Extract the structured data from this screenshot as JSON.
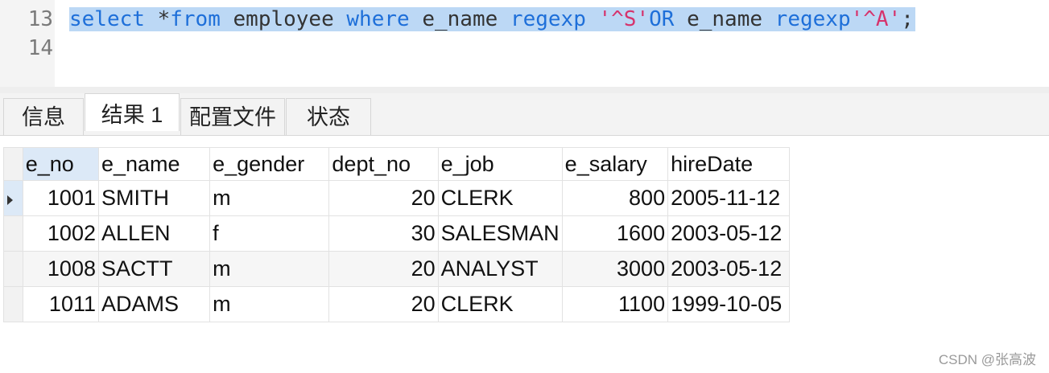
{
  "editor": {
    "lines": [
      {
        "number": "13"
      },
      {
        "number": "14"
      }
    ],
    "sql": {
      "kw_select": "select",
      "sp1": " ",
      "star": "*",
      "kw_from": "from",
      "sp2": " ",
      "table": "employee",
      "sp3": " ",
      "kw_where": "where",
      "sp4": " ",
      "col1": "e_name",
      "sp5": " ",
      "kw_regexp1": "regexp",
      "sp6": " ",
      "str1": "'^S'",
      "kw_or": "OR",
      "sp7": " ",
      "col2": "e_name",
      "sp8": " ",
      "kw_regexp2": "regexp",
      "str2": "'^A'",
      "semi": ";"
    }
  },
  "tabs": [
    {
      "label": "信息"
    },
    {
      "label": "结果 1"
    },
    {
      "label": "配置文件"
    },
    {
      "label": "状态"
    }
  ],
  "grid": {
    "columns": [
      "e_no",
      "e_name",
      "e_gender",
      "dept_no",
      "e_job",
      "e_salary",
      "hireDate"
    ],
    "rows": [
      {
        "e_no": "1001",
        "e_name": "SMITH",
        "e_gender": "m",
        "dept_no": "20",
        "e_job": "CLERK",
        "e_salary": "800",
        "hireDate": "2005-11-12"
      },
      {
        "e_no": "1002",
        "e_name": "ALLEN",
        "e_gender": "f",
        "dept_no": "30",
        "e_job": "SALESMAN",
        "e_salary": "1600",
        "hireDate": "2003-05-12"
      },
      {
        "e_no": "1008",
        "e_name": "SACTT",
        "e_gender": "m",
        "dept_no": "20",
        "e_job": "ANALYST",
        "e_salary": "3000",
        "hireDate": "2003-05-12"
      },
      {
        "e_no": "1011",
        "e_name": "ADAMS",
        "e_gender": "m",
        "dept_no": "20",
        "e_job": "CLERK",
        "e_salary": "1100",
        "hireDate": "1999-10-05"
      }
    ]
  },
  "watermark": "CSDN @张高波",
  "colors": {
    "keyword": "#1e6fd9",
    "string": "#d6336c",
    "selection": "#bcd8f5"
  }
}
